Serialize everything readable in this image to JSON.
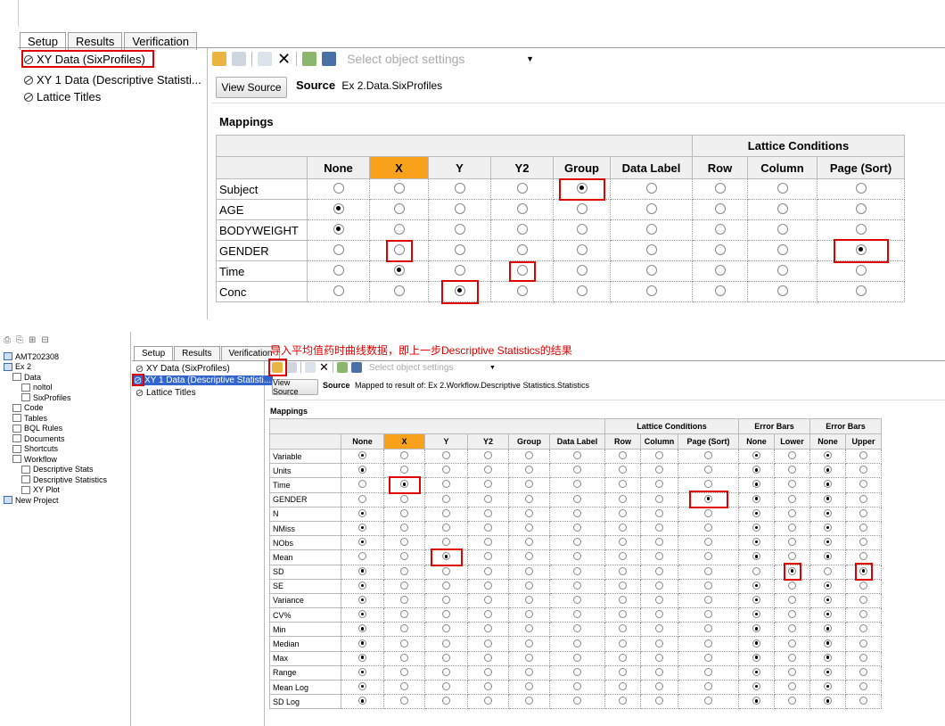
{
  "top": {
    "tabs": [
      "Setup",
      "Results",
      "Verification"
    ],
    "tree": [
      "XY Data (SixProfiles)",
      "XY 1 Data (Descriptive Statisti...",
      "Lattice Titles"
    ],
    "toolbar_dropdown": "Select object settings",
    "view_source": "View Source",
    "source_label": "Source",
    "source_value": "Ex 2.Data.SixProfiles",
    "mappings_label": "Mappings",
    "group_header": "Lattice Conditions",
    "columns": [
      "None",
      "X",
      "Y",
      "Y2",
      "Group",
      "Data Label",
      "Row",
      "Column",
      "Page (Sort)"
    ],
    "rows": [
      {
        "label": "Subject",
        "sel": 4
      },
      {
        "label": "AGE",
        "sel": 0
      },
      {
        "label": "BODYWEIGHT",
        "sel": 0
      },
      {
        "label": "GENDER",
        "sel": 8
      },
      {
        "label": "Time",
        "sel": 1
      },
      {
        "label": "Conc",
        "sel": 2
      }
    ]
  },
  "bottom": {
    "annotation": "导入平均值药时曲线数据，即上一步Descriptive Statistics的结果",
    "project_tree": [
      {
        "label": "AMT202308",
        "level": 0
      },
      {
        "label": "Ex 2",
        "level": 0
      },
      {
        "label": "Data",
        "level": 1
      },
      {
        "label": "noltol",
        "level": 2
      },
      {
        "label": "SixProfiles",
        "level": 2
      },
      {
        "label": "Code",
        "level": 1
      },
      {
        "label": "Tables",
        "level": 1
      },
      {
        "label": "BQL Rules",
        "level": 1
      },
      {
        "label": "Documents",
        "level": 1
      },
      {
        "label": "Shortcuts",
        "level": 1
      },
      {
        "label": "Workflow",
        "level": 1
      },
      {
        "label": "Descriptive Stats",
        "level": 2
      },
      {
        "label": "Descriptive Statistics",
        "level": 2
      },
      {
        "label": "XY Plot",
        "level": 2
      },
      {
        "label": "New Project",
        "level": 0
      }
    ],
    "tabs": [
      "Setup",
      "Results",
      "Verification"
    ],
    "tree": [
      "XY Data (SixProfiles)",
      "XY 1 Data (Descriptive Statisti...",
      "Lattice Titles"
    ],
    "toolbar_dropdown": "Select object settings",
    "view_source": "View Source",
    "source_label": "Source",
    "source_value": "Mapped to result of: Ex 2.Workflow.Descriptive Statistics.Statistics",
    "mappings_label": "Mappings",
    "group_lattice": "Lattice Conditions",
    "group_err1": "Error Bars",
    "group_err2": "Error Bars",
    "columns": [
      "None",
      "X",
      "Y",
      "Y2",
      "Group",
      "Data Label",
      "Row",
      "Column",
      "Page (Sort)",
      "None",
      "Lower",
      "None",
      "Upper"
    ],
    "rows": [
      {
        "label": "Variable",
        "sel": [
          0,
          9,
          11
        ]
      },
      {
        "label": "Units",
        "sel": [
          0,
          9,
          11
        ]
      },
      {
        "label": "Time",
        "sel": [
          1,
          9,
          11
        ]
      },
      {
        "label": "GENDER",
        "sel": [
          8,
          9,
          11
        ]
      },
      {
        "label": "N",
        "sel": [
          0,
          9,
          11
        ]
      },
      {
        "label": "NMiss",
        "sel": [
          0,
          9,
          11
        ]
      },
      {
        "label": "NObs",
        "sel": [
          0,
          9,
          11
        ]
      },
      {
        "label": "Mean",
        "sel": [
          2,
          9,
          11
        ]
      },
      {
        "label": "SD",
        "sel": [
          0,
          10,
          12
        ]
      },
      {
        "label": "SE",
        "sel": [
          0,
          9,
          11
        ]
      },
      {
        "label": "Variance",
        "sel": [
          0,
          9,
          11
        ]
      },
      {
        "label": "CV%",
        "sel": [
          0,
          9,
          11
        ]
      },
      {
        "label": "Min",
        "sel": [
          0,
          9,
          11
        ]
      },
      {
        "label": "Median",
        "sel": [
          0,
          9,
          11
        ]
      },
      {
        "label": "Max",
        "sel": [
          0,
          9,
          11
        ]
      },
      {
        "label": "Range",
        "sel": [
          0,
          9,
          11
        ]
      },
      {
        "label": "Mean Log",
        "sel": [
          0,
          9,
          11
        ]
      },
      {
        "label": "SD Log",
        "sel": [
          0,
          9,
          11
        ]
      }
    ]
  },
  "colors": {
    "highlight": "#f7a21a",
    "annotation_red": "#e00000",
    "selection_blue": "#3366cc"
  }
}
